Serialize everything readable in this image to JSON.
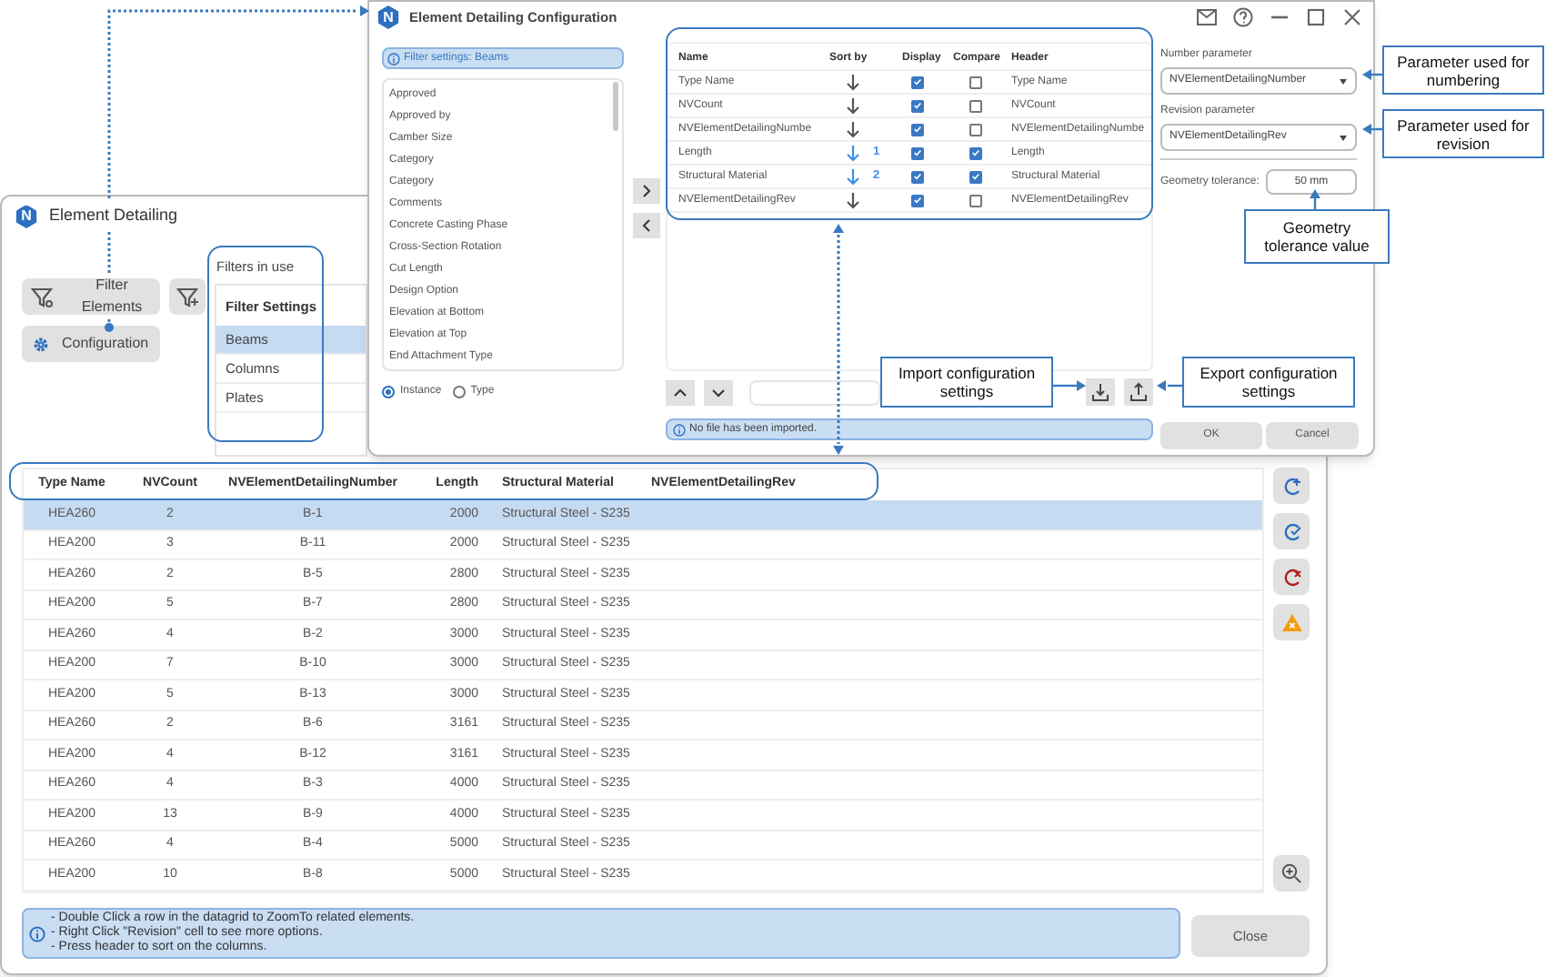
{
  "main_window": {
    "logo_letter": "N",
    "title": "Element Detailing",
    "buttons": [
      {
        "kind": "filter",
        "label": "Filter Elements"
      },
      {
        "kind": "filter_add"
      },
      {
        "kind": "settings",
        "label": "Configuration"
      }
    ],
    "filters": {
      "label": "Filters in use",
      "header": "Filter Settings",
      "items": [
        {
          "label": "Beams",
          "selected": true
        },
        {
          "label": "Columns",
          "selected": false
        },
        {
          "label": "Plates",
          "selected": false
        }
      ]
    },
    "table": {
      "columns": [
        "Type Name",
        "NVCount",
        "NVElementDetailingNumber",
        "Length",
        "Structural Material",
        "NVElementDetailingRev"
      ],
      "rows": [
        {
          "cells": [
            "HEA260",
            "2",
            "B-1",
            "2000",
            "Structural Steel - S235"
          ],
          "selected": true
        },
        {
          "cells": [
            "HEA200",
            "3",
            "B-11",
            "2000",
            "Structural Steel - S235"
          ],
          "selected": false
        },
        {
          "cells": [
            "HEA260",
            "2",
            "B-5",
            "2800",
            "Structural Steel - S235"
          ],
          "selected": false
        },
        {
          "cells": [
            "HEA200",
            "5",
            "B-7",
            "2800",
            "Structural Steel - S235"
          ],
          "selected": false
        },
        {
          "cells": [
            "HEA260",
            "4",
            "B-2",
            "3000",
            "Structural Steel - S235"
          ],
          "selected": false
        },
        {
          "cells": [
            "HEA200",
            "7",
            "B-10",
            "3000",
            "Structural Steel - S235"
          ],
          "selected": false
        },
        {
          "cells": [
            "HEA200",
            "5",
            "B-13",
            "3000",
            "Structural Steel - S235"
          ],
          "selected": false
        },
        {
          "cells": [
            "HEA260",
            "2",
            "B-6",
            "3161",
            "Structural Steel - S235"
          ],
          "selected": false
        },
        {
          "cells": [
            "HEA200",
            "4",
            "B-12",
            "3161",
            "Structural Steel - S235"
          ],
          "selected": false
        },
        {
          "cells": [
            "HEA260",
            "4",
            "B-3",
            "4000",
            "Structural Steel - S235"
          ],
          "selected": false
        },
        {
          "cells": [
            "HEA200",
            "13",
            "B-9",
            "4000",
            "Structural Steel - S235"
          ],
          "selected": false
        },
        {
          "cells": [
            "HEA260",
            "4",
            "B-4",
            "5000",
            "Structural Steel - S235"
          ],
          "selected": false
        },
        {
          "cells": [
            "HEA200",
            "10",
            "B-8",
            "5000",
            "Structural Steel - S235"
          ],
          "selected": false
        }
      ]
    },
    "info_lines": [
      "- Double Click a row in the datagrid to ZoomTo related elements.",
      "- Right Click \"Revision\" cell to see more options.",
      "- Press header to sort on the columns."
    ],
    "close_button": "Close"
  },
  "config_window": {
    "logo_letter": "N",
    "title": "Element Detailing Configuration",
    "filter_info": "Filter settings: Beams",
    "fields": [
      "Approved",
      "Approved by",
      "Camber Size",
      "Category",
      "Category",
      "Comments",
      "Concrete Casting Phase",
      "Cross-Section Rotation",
      "Cut Length",
      "Design Option",
      "Elevation at Bottom",
      "Elevation at Top",
      "End Attachment Type"
    ],
    "scope_options": [
      {
        "label": "Instance",
        "selected": true
      },
      {
        "label": "Type",
        "selected": false
      }
    ],
    "grid": {
      "columns": [
        "Name",
        "Sort by",
        "Display",
        "Compare",
        "Header"
      ],
      "rows": [
        {
          "name": "Type Name",
          "sort_active": false,
          "display": true,
          "compare": false,
          "header": "Type Name"
        },
        {
          "name": "NVCount",
          "sort_active": false,
          "display": true,
          "compare": false,
          "header": "NVCount"
        },
        {
          "name": "NVElementDetailingNumbe",
          "sort_active": false,
          "display": true,
          "compare": false,
          "header": "NVElementDetailingNumbe"
        },
        {
          "name": "Length",
          "sort_active": true,
          "sort_rank": "1",
          "display": true,
          "compare": true,
          "header": "Length"
        },
        {
          "name": "Structural Material",
          "sort_active": true,
          "sort_rank": "2",
          "display": true,
          "compare": true,
          "header": "Structural Material"
        },
        {
          "name": "NVElementDetailingRev",
          "sort_active": false,
          "display": true,
          "compare": false,
          "header": "NVElementDetailingRev"
        }
      ]
    },
    "import_status": "No file has been imported.",
    "number_parameter": {
      "label": "Number parameter",
      "value": "NVElementDetailingNumber"
    },
    "revision_parameter": {
      "label": "Revision parameter",
      "value": "NVElementDetailingRev"
    },
    "geometry_tolerance": {
      "label": "Geometry tolerance:",
      "value": "50 mm"
    },
    "buttons": [
      "OK",
      "Cancel"
    ]
  },
  "callouts": [
    {
      "kind": "number",
      "text": "Parameter used for numbering"
    },
    {
      "kind": "revision",
      "text": "Parameter used for revision"
    },
    {
      "kind": "tolerance",
      "text": "Geometry tolerance value"
    },
    {
      "kind": "import",
      "text": "Import configuration settings"
    },
    {
      "kind": "export",
      "text": "Export configuration settings"
    }
  ]
}
